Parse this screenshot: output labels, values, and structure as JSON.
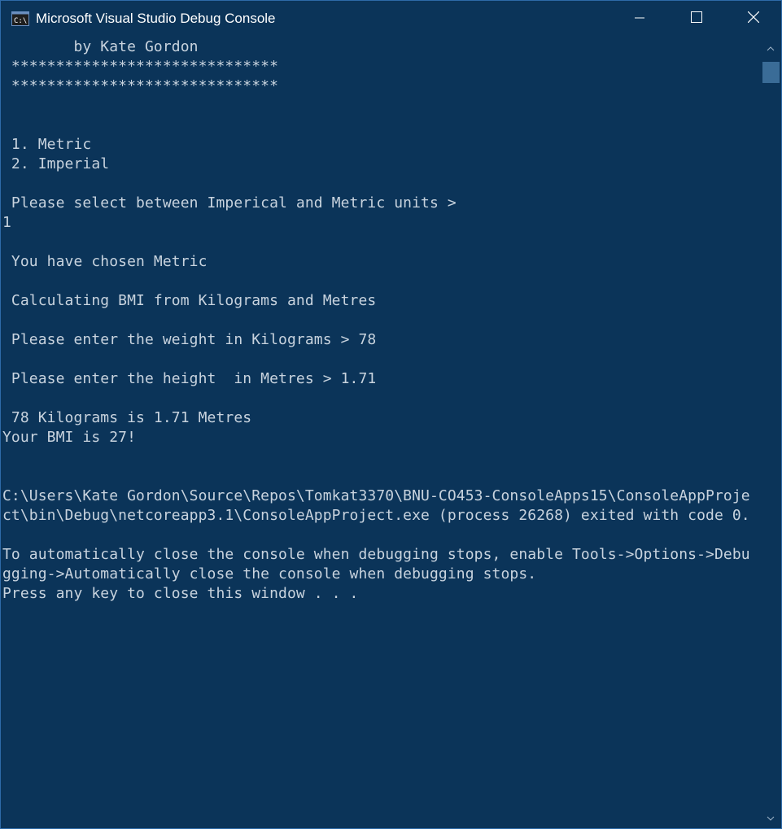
{
  "window": {
    "title": "Microsoft Visual Studio Debug Console",
    "icon": "console-app-icon",
    "controls": {
      "minimize_icon": "minimize-icon",
      "maximize_icon": "maximize-icon",
      "close_icon": "close-icon"
    }
  },
  "console": {
    "lines": [
      "        by Kate Gordon",
      " ******************************",
      " ******************************",
      "",
      "",
      " 1. Metric",
      " 2. Imperial",
      "",
      " Please select between Imperical and Metric units >",
      "1",
      "",
      " You have chosen Metric",
      "",
      " Calculating BMI from Kilograms and Metres",
      "",
      " Please enter the weight in Kilograms > 78",
      "",
      " Please enter the height  in Metres > 1.71",
      "",
      " 78 Kilograms is 1.71 Metres",
      "Your BMI is 27!",
      "",
      "",
      "C:\\Users\\Kate Gordon\\Source\\Repos\\Tomkat3370\\BNU-CO453-ConsoleApps15\\ConsoleAppProje",
      "ct\\bin\\Debug\\netcoreapp3.1\\ConsoleAppProject.exe (process 26268) exited with code 0.",
      "",
      "To automatically close the console when debugging stops, enable Tools->Options->Debu",
      "gging->Automatically close the console when debugging stops.",
      "Press any key to close this window . . ."
    ]
  },
  "colors": {
    "background": "#0b3459",
    "text": "#c8d3de",
    "scroll_thumb": "#3a6c97"
  }
}
